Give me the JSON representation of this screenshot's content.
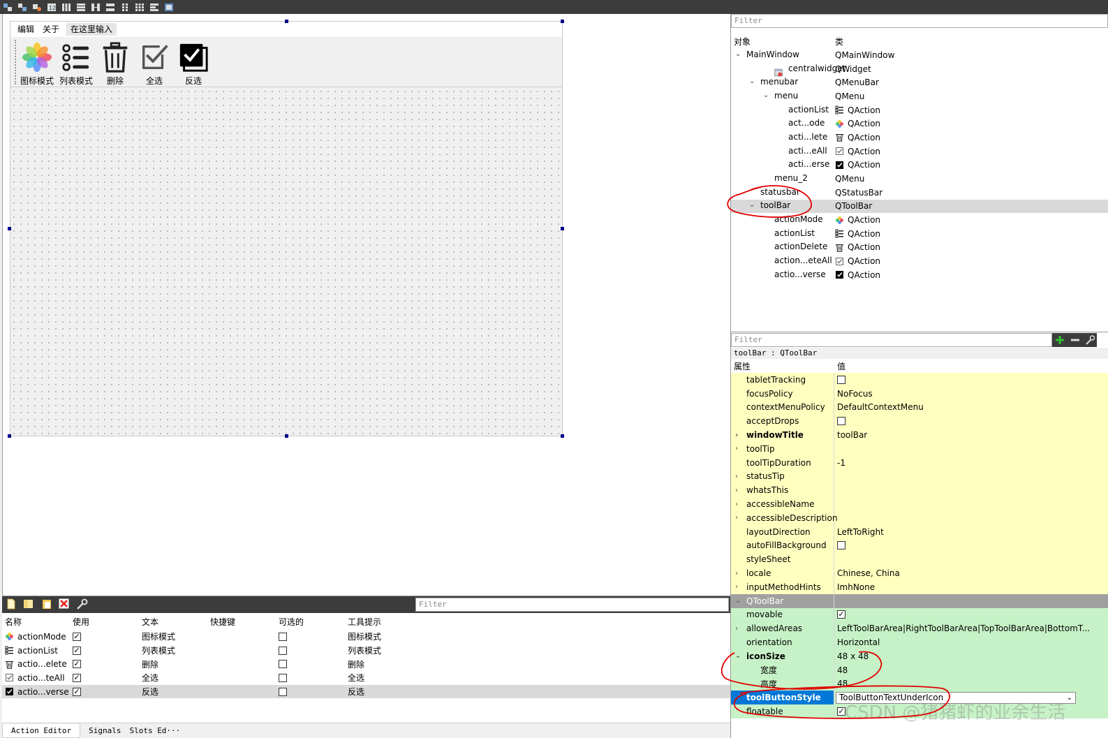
{
  "form": {
    "menubar": {
      "edit": "编辑",
      "about": "关于",
      "type_here": "在这里输入"
    },
    "toolbar": [
      {
        "label": "图标模式",
        "icon": "photos-icon"
      },
      {
        "label": "列表模式",
        "icon": "list-icon"
      },
      {
        "label": "删除",
        "icon": "trash-icon"
      },
      {
        "label": "全选",
        "icon": "checkbox-icon"
      },
      {
        "label": "反选",
        "icon": "checkbox-filled-icon"
      }
    ]
  },
  "action_editor": {
    "filter_placeholder": "Filter",
    "headers": [
      "名称",
      "使用",
      "文本",
      "快捷键",
      "可选的",
      "工具提示"
    ],
    "rows": [
      {
        "name": "actionMode",
        "used": true,
        "text": "图标模式",
        "checkable": false,
        "tooltip": "图标模式",
        "icon": "photos-icon"
      },
      {
        "name": "actionList",
        "used": true,
        "text": "列表模式",
        "checkable": false,
        "tooltip": "列表模式",
        "icon": "list-icon"
      },
      {
        "name": "actio...elete",
        "used": true,
        "text": "删除",
        "checkable": false,
        "tooltip": "删除",
        "icon": "trash-icon"
      },
      {
        "name": "actio...teAll",
        "used": true,
        "text": "全选",
        "checkable": false,
        "tooltip": "全选",
        "icon": "checkbox-icon"
      },
      {
        "name": "actio...verse",
        "used": true,
        "text": "反选",
        "checkable": false,
        "tooltip": "反选",
        "icon": "checkbox-filled-icon"
      }
    ],
    "tabs": [
      "Action Editor",
      "Signals",
      "Slots Ed···"
    ]
  },
  "object_inspector": {
    "filter_placeholder": "Filter",
    "headers": [
      "对象",
      "类"
    ],
    "rows": [
      {
        "name": "MainWindow",
        "class": "QMainWindow",
        "level": 0,
        "expanded": true
      },
      {
        "name": "centralwidget",
        "class": "QWidget",
        "level": 1,
        "icon": "widget-icon"
      },
      {
        "name": "menubar",
        "class": "QMenuBar",
        "level": 1,
        "expanded": true
      },
      {
        "name": "menu",
        "class": "QMenu",
        "level": 2,
        "expanded": true
      },
      {
        "name": "actionList",
        "class": "QAction",
        "level": 3,
        "icon": "list-icon"
      },
      {
        "name": "act...ode",
        "class": "QAction",
        "level": 3,
        "icon": "photos-icon"
      },
      {
        "name": "acti...lete",
        "class": "QAction",
        "level": 3,
        "icon": "trash-icon"
      },
      {
        "name": "acti...eAll",
        "class": "QAction",
        "level": 3,
        "icon": "checkbox-icon"
      },
      {
        "name": "acti...erse",
        "class": "QAction",
        "level": 3,
        "icon": "checkbox-filled-icon"
      },
      {
        "name": "menu_2",
        "class": "QMenu",
        "level": 2
      },
      {
        "name": "statusbar",
        "class": "QStatusBar",
        "level": 1
      },
      {
        "name": "toolBar",
        "class": "QToolBar",
        "level": 1,
        "expanded": true,
        "selected": true
      },
      {
        "name": "actionMode",
        "class": "QAction",
        "level": 2,
        "icon": "photos-icon"
      },
      {
        "name": "actionList",
        "class": "QAction",
        "level": 2,
        "icon": "list-icon"
      },
      {
        "name": "actionDelete",
        "class": "QAction",
        "level": 2,
        "icon": "trash-icon"
      },
      {
        "name": "action...eteAll",
        "class": "QAction",
        "level": 2,
        "icon": "checkbox-icon"
      },
      {
        "name": "actio...verse",
        "class": "QAction",
        "level": 2,
        "icon": "checkbox-filled-icon"
      }
    ]
  },
  "property_editor": {
    "filter_placeholder": "Filter",
    "class_label": "toolBar : QToolBar",
    "headers": [
      "属性",
      "值"
    ],
    "rows": [
      {
        "name": "tabletTracking",
        "value": "",
        "checkbox": false,
        "style": "yel"
      },
      {
        "name": "focusPolicy",
        "value": "NoFocus",
        "style": "yel"
      },
      {
        "name": "contextMenuPolicy",
        "value": "DefaultContextMenu",
        "style": "yel"
      },
      {
        "name": "acceptDrops",
        "value": "",
        "checkbox": false,
        "style": "yel"
      },
      {
        "name": "windowTitle",
        "value": "toolBar",
        "style": "yel",
        "bold": true,
        "expandable": true
      },
      {
        "name": "toolTip",
        "value": "",
        "style": "yel",
        "expandable": true
      },
      {
        "name": "toolTipDuration",
        "value": "-1",
        "style": "yel"
      },
      {
        "name": "statusTip",
        "value": "",
        "style": "yel",
        "expandable": true
      },
      {
        "name": "whatsThis",
        "value": "",
        "style": "yel",
        "expandable": true
      },
      {
        "name": "accessibleName",
        "value": "",
        "style": "yel",
        "expandable": true
      },
      {
        "name": "accessibleDescription",
        "value": "",
        "style": "yel",
        "expandable": true
      },
      {
        "name": "layoutDirection",
        "value": "LeftToRight",
        "style": "yel"
      },
      {
        "name": "autoFillBackground",
        "value": "",
        "checkbox": false,
        "style": "yel"
      },
      {
        "name": "styleSheet",
        "value": "",
        "style": "yel"
      },
      {
        "name": "locale",
        "value": "Chinese, China",
        "style": "yel",
        "expandable": true
      },
      {
        "name": "inputMethodHints",
        "value": "ImhNone",
        "style": "yel",
        "expandable": true
      },
      {
        "name": "QToolBar",
        "value": "",
        "style": "sect",
        "expanded": true
      },
      {
        "name": "movable",
        "value": "",
        "checkbox": true,
        "style": "grn"
      },
      {
        "name": "allowedAreas",
        "value": "LeftToolBarArea|RightToolBarArea|TopToolBarArea|BottomT...",
        "style": "grn",
        "expandable": true
      },
      {
        "name": "orientation",
        "value": "Horizontal",
        "style": "grn"
      },
      {
        "name": "iconSize",
        "value": "48 x 48",
        "style": "grn",
        "bold": true,
        "expanded": true
      },
      {
        "name": "宽度",
        "value": "48",
        "style": "grn",
        "indent": true
      },
      {
        "name": "高度",
        "value": "48",
        "style": "grn",
        "indent": true
      },
      {
        "name": "toolButtonStyle",
        "value": "ToolButtonTextUnderIcon",
        "style": "grn",
        "bold": true,
        "editing": true
      },
      {
        "name": "floatable",
        "value": "",
        "checkbox": true,
        "style": "grn"
      }
    ]
  },
  "watermark": "CSDN @猪猪虾的业余生活",
  "colors": {
    "selection": "#0078d7",
    "annotation": "#e00000",
    "designable_yellow": "#ffffc0",
    "toolbar_green": "#c7f2c7"
  }
}
